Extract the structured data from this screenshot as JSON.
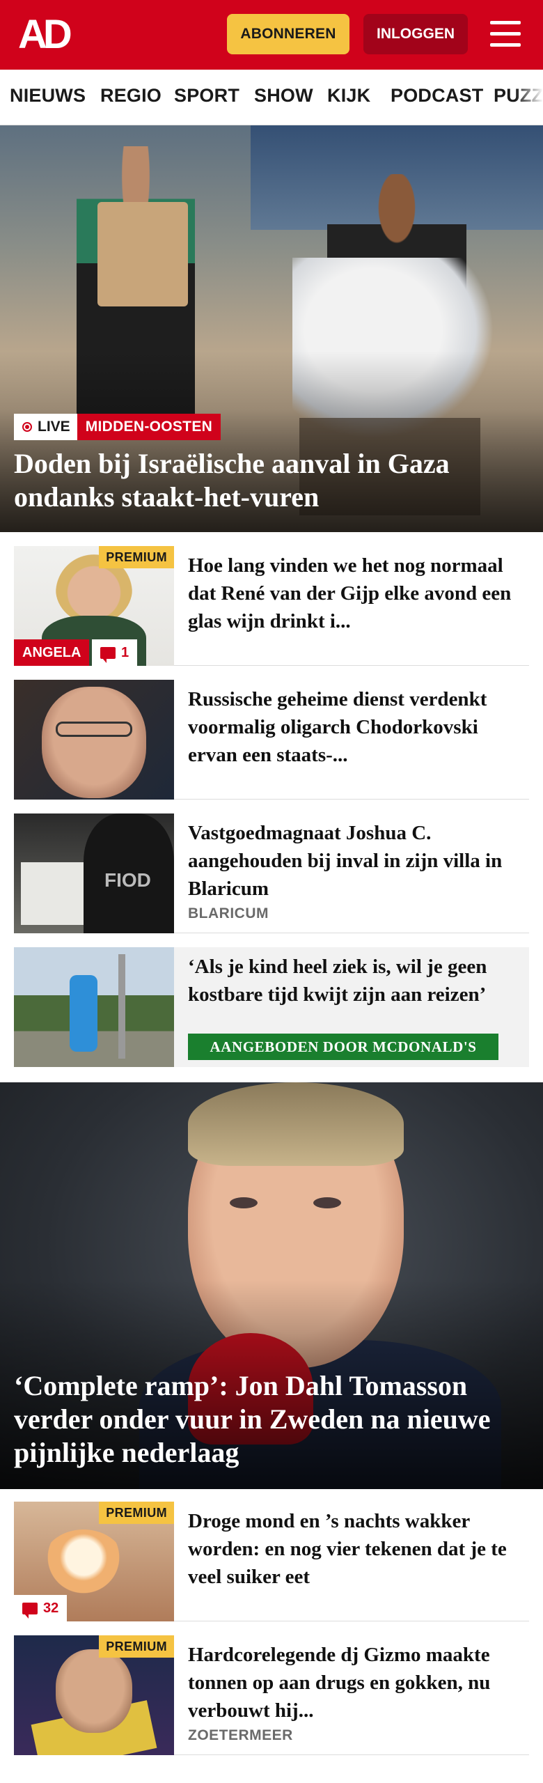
{
  "header": {
    "logo_text": "AD",
    "subscribe_label": "ABONNEREN",
    "login_label": "INLOGGEN",
    "brand_color": "#d0021b"
  },
  "nav": {
    "items": [
      "NIEUWS",
      "REGIO",
      "SPORT",
      "SHOW",
      "KIJK",
      "PODCAST",
      "PUZZ"
    ]
  },
  "hero1": {
    "live_label": "LIVE",
    "category": "MIDDEN-OOSTEN",
    "title": "Doden bij Israëlische aanval in Gaza ondanks staakt-het-vuren"
  },
  "articles": [
    {
      "title": "Hoe lang vinden we het nog normaal dat René van der Gijp elke avond een glas wijn drinkt i...",
      "premium": "PREMIUM",
      "category": "ANGELA",
      "comments": "1"
    },
    {
      "title": "Russische geheime dienst verdenkt voormalig oligarch Chodorkovski ervan een staats-..."
    },
    {
      "title": "Vastgoedmagnaat Joshua C. aangehouden bij inval in zijn villa in Blaricum",
      "kicker": "BLARICUM",
      "thumb_text": "FIOD"
    },
    {
      "title": "‘Als je kind heel ziek is, wil je geen kostbare tijd kwijt zijn aan reizen’",
      "sponsor": "AANGEBODEN DOOR MCDONALD'S"
    }
  ],
  "hero2": {
    "title": "‘Complete ramp’: Jon Dahl Tomasson verder onder vuur in Zweden na nieuwe pijnlijke nederlaag"
  },
  "articles2": [
    {
      "title": "Droge mond en ’s nachts wakker worden: en nog vier tekenen dat je te veel suiker eet",
      "premium": "PREMIUM",
      "comments": "32"
    },
    {
      "title": "Hardcorelegende dj Gizmo maakte tonnen op aan drugs en gokken, nu verbouwt hij...",
      "premium": "PREMIUM",
      "kicker": "ZOETERMEER"
    }
  ]
}
